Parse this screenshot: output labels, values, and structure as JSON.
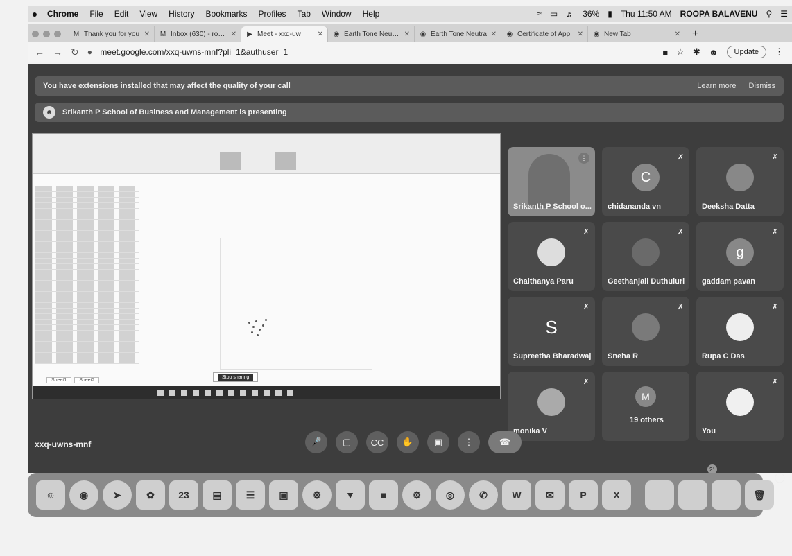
{
  "menubar": {
    "apple": "",
    "items": [
      "Chrome",
      "File",
      "Edit",
      "View",
      "History",
      "Bookmarks",
      "Profiles",
      "Tab",
      "Window",
      "Help"
    ],
    "battery": "36%",
    "clock": "Thu 11:50 AM",
    "user": "ROOPA BALAVENU"
  },
  "tabs": [
    {
      "icon": "M",
      "label": "Thank you for you"
    },
    {
      "icon": "M",
      "label": "Inbox (630) - roopa"
    },
    {
      "icon": "▶",
      "label": "Meet - xxq-uw"
    },
    {
      "icon": "◉",
      "label": "Earth Tone Neutral"
    },
    {
      "icon": "◉",
      "label": "Earth Tone Neutra"
    },
    {
      "icon": "◉",
      "label": "Certificate of App"
    },
    {
      "icon": "◉",
      "label": "New Tab"
    }
  ],
  "omnibox": {
    "url": "meet.google.com/xxq-uwns-mnf?pli=1&authuser=1",
    "update": "Update"
  },
  "banners": {
    "extensions": "You have extensions installed that may affect the quality of your call",
    "learn_more": "Learn more",
    "dismiss": "Dismiss",
    "presenting": "Srikanth P School of Business and Management is presenting"
  },
  "shared_screen": {
    "sheet_tabs": [
      "Sheet1",
      "Sheet2"
    ],
    "stop_text": "Stop sharing"
  },
  "participants": [
    {
      "name": "Srikanth P School o...",
      "initial": "",
      "video": true
    },
    {
      "name": "chidananda vn",
      "initial": "C"
    },
    {
      "name": "Deeksha Datta",
      "initial": ""
    },
    {
      "name": "Chaithanya Paru",
      "initial": ""
    },
    {
      "name": "Geethanjali Duthuluri",
      "initial": ""
    },
    {
      "name": "gaddam pavan",
      "initial": "g"
    },
    {
      "name": "Supreetha Bharadwaj",
      "initial": "S"
    },
    {
      "name": "Sneha R",
      "initial": ""
    },
    {
      "name": "Rupa C Das",
      "initial": ""
    },
    {
      "name": "monika V",
      "initial": ""
    },
    {
      "name": "19 others",
      "initial": "M"
    },
    {
      "name": "You",
      "initial": ""
    }
  ],
  "meeting_code": "xxq-uwns-mnf",
  "people_count": "21",
  "dock": {
    "calendar_day": "23",
    "word": "W",
    "powerpoint": "P",
    "excel": "X"
  }
}
